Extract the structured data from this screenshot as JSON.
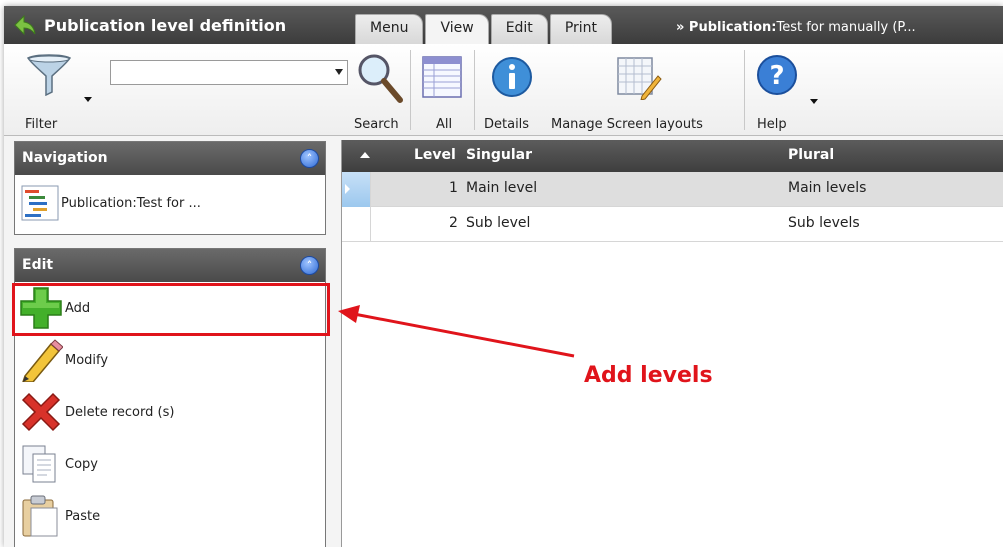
{
  "header": {
    "title": "Publication level definition",
    "tabs": [
      {
        "label": "Menu"
      },
      {
        "label": "View"
      },
      {
        "label": "Edit"
      },
      {
        "label": "Print"
      }
    ],
    "breadcrumb_prefix": "» Publication:",
    "breadcrumb_text": "Test for manually (P..."
  },
  "ribbon": {
    "filter_label": "Filter",
    "search_value": "",
    "search_label": "Search",
    "all_label": "All",
    "details_label": "Details",
    "manage_label": "Manage Screen layouts",
    "help_label": "Help"
  },
  "navigation": {
    "title": "Navigation",
    "item_label": "Publication:Test for ..."
  },
  "edit": {
    "title": "Edit",
    "items": [
      {
        "label": "Add",
        "icon": "plus-icon"
      },
      {
        "label": "Modify",
        "icon": "pencil-icon"
      },
      {
        "label": "Delete record (s)",
        "icon": "delete-icon"
      },
      {
        "label": "Copy",
        "icon": "copy-icon"
      },
      {
        "label": "Paste",
        "icon": "paste-icon"
      }
    ]
  },
  "grid": {
    "columns": [
      "Level",
      "Singular",
      "Plural"
    ],
    "rows": [
      {
        "level": "1",
        "singular": "Main level",
        "plural": "Main levels"
      },
      {
        "level": "2",
        "singular": "Sub level",
        "plural": "Sub levels"
      }
    ]
  },
  "annotation": {
    "text": "Add levels",
    "color": "#e0141b"
  },
  "colors": {
    "header_dark": "#4a4a4a",
    "selection_blue": "#9cc8ee",
    "annotation_red": "#e0141b"
  }
}
